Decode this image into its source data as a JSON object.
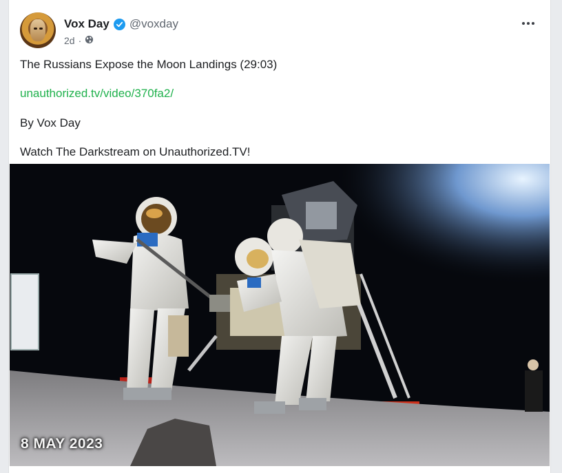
{
  "post": {
    "author": {
      "name": "Vox Day",
      "handle": "@voxday",
      "verified": true,
      "avatar_icon": "avatar-image"
    },
    "timestamp": "2d",
    "visibility_icon": "globe-icon",
    "more_icon": "more-options-icon",
    "lines": {
      "title": "The Russians Expose the Moon Landings (29:03)",
      "link": "unauthorized.tv/video/370fa2/",
      "byline": "By Vox Day",
      "cta": "Watch The Darkstream on Unauthorized.TV!"
    },
    "media": {
      "overlay_text": "8 MAY 2023"
    }
  },
  "colors": {
    "link": "#1fb14c",
    "verified": "#1d9bf0",
    "text": "#1c1e21",
    "muted": "#606770"
  }
}
